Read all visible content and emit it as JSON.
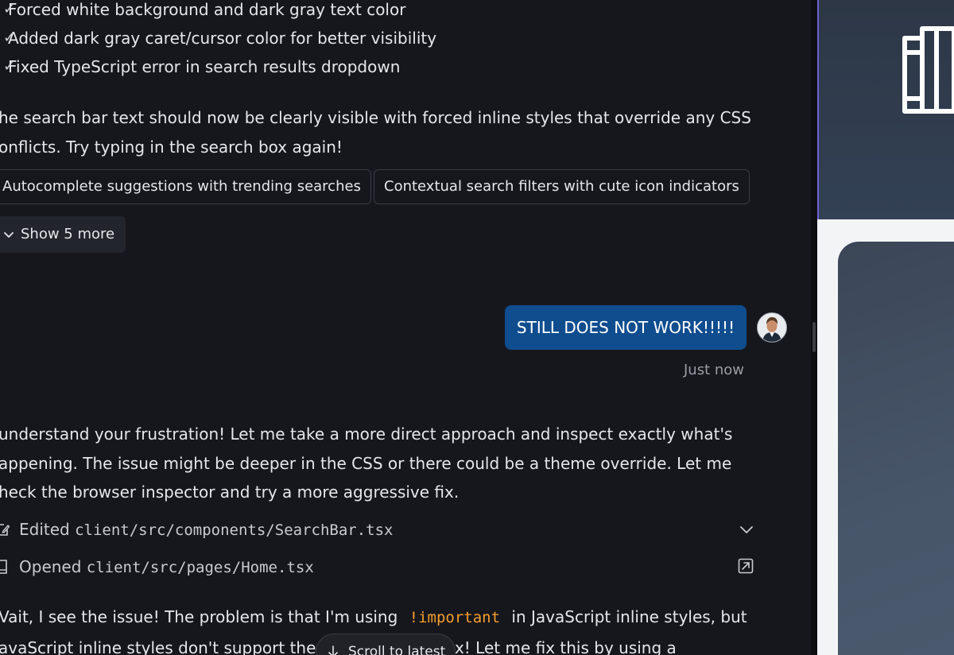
{
  "chat": {
    "bullets": [
      "Forced white background and dark gray text color",
      "Added dark gray caret/cursor color for better visibility",
      "Fixed TypeScript error in search results dropdown"
    ],
    "summary_lines": [
      "he search bar text should now be clearly visible with forced inline styles that override any CSS",
      "onflicts. Try typing in the search box again!"
    ],
    "suggestions": [
      "Autocomplete suggestions with trending searches",
      "Contextual search filters with cute icon indicators"
    ],
    "show_more_label": "Show 5 more",
    "user_message": "STILL DOES NOT WORK!!!!!",
    "user_timestamp": "Just now",
    "reply_lines": [
      "understand your frustration! Let me take a more direct approach and inspect exactly what's",
      "appening. The issue might be deeper in the CSS or there could be a theme override. Let me",
      "heck the browser inspector and try a more aggressive fix."
    ],
    "actions": [
      {
        "verb": "Edited",
        "path": "client/src/components/SearchBar.tsx",
        "icon": "edit-icon",
        "action_icon": "chevron-down-icon"
      },
      {
        "verb": "Opened",
        "path": "client/src/pages/Home.tsx",
        "icon": "file-icon",
        "action_icon": "open-external-icon"
      }
    ],
    "last_line1_before": "Vait, I see the issue! The problem is that I'm using ",
    "last_line1_code": "!important",
    "last_line1_after": " in JavaScript inline styles, but",
    "last_line2": "avaScript inline styles don't support the !important syntax! Let me fix this by using a",
    "scroll_to_latest_label": "Scroll to latest"
  },
  "colors": {
    "background": "#16171d",
    "user_bubble": "#0f4d8f",
    "code_accent": "#f59e2d",
    "preview_header": "#334155"
  }
}
